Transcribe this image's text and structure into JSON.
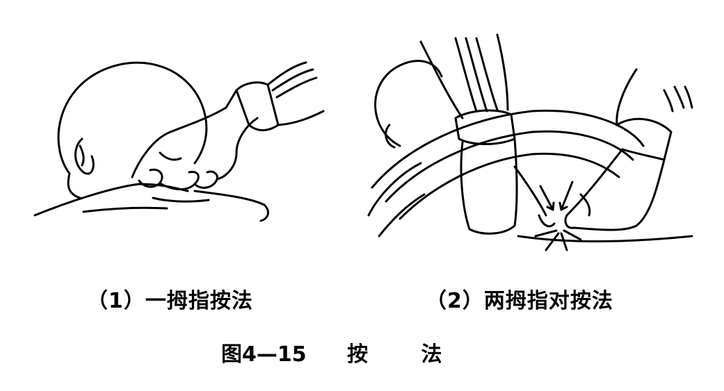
{
  "panels": [
    {
      "caption": "（1）一拇指按法"
    },
    {
      "caption": "（2）两拇指对按法"
    }
  ],
  "figure": {
    "number": "图4—15",
    "title_char_1": "按",
    "title_char_2": "法"
  }
}
